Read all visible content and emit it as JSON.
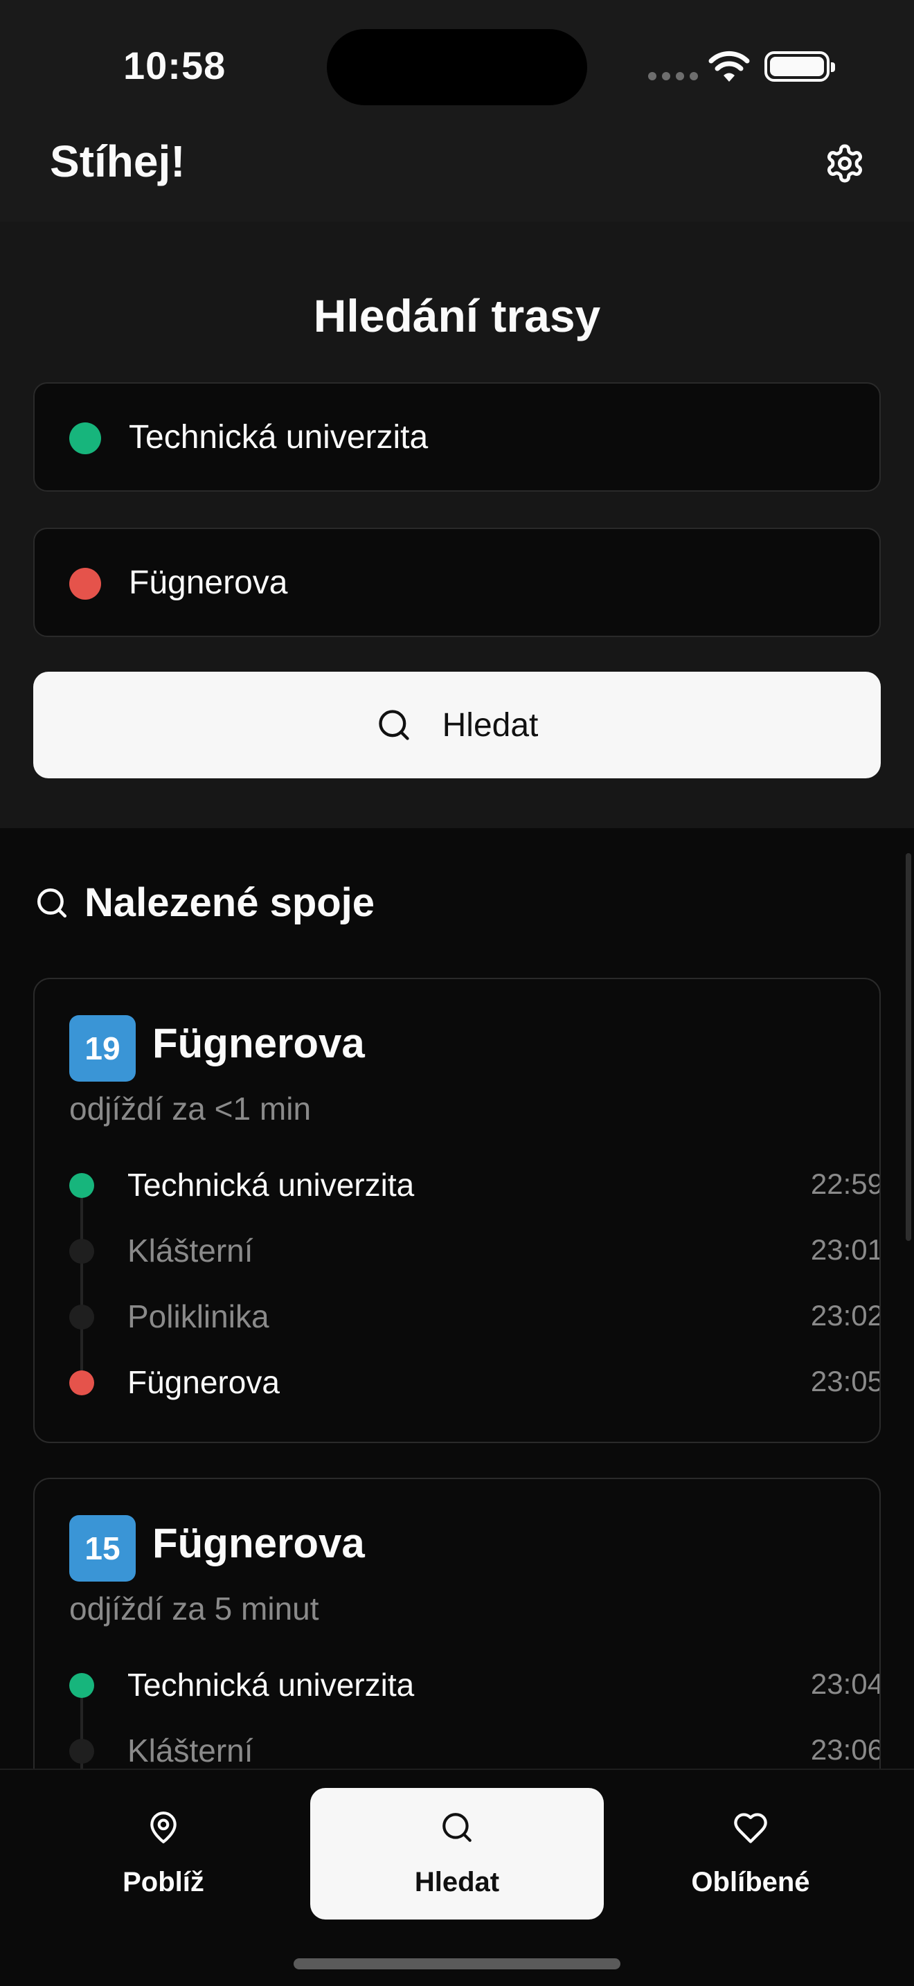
{
  "status": {
    "time": "10:58"
  },
  "header": {
    "title": "Stíhej!",
    "settings_icon": "gear-icon"
  },
  "search": {
    "title": "Hledání trasy",
    "from": {
      "value": "Technická univerzita",
      "color": "#17b57c"
    },
    "to": {
      "value": "Fügnerova",
      "color": "#e5534b"
    },
    "button_label": "Hledat"
  },
  "results": {
    "title": "Nalezené spoje",
    "connections": [
      {
        "line": "19",
        "line_color": "#3a95d6",
        "destination": "Fügnerova",
        "departure": "odjíždí za <1 min",
        "stops": [
          {
            "name": "Technická univerzita",
            "time": "22:59"
          },
          {
            "name": "Klášterní",
            "time": "23:01"
          },
          {
            "name": "Poliklinika",
            "time": "23:02"
          },
          {
            "name": "Fügnerova",
            "time": "23:05"
          }
        ]
      },
      {
        "line": "15",
        "line_color": "#3a95d6",
        "destination": "Fügnerova",
        "departure": "odjíždí za 5 minut",
        "stops": [
          {
            "name": "Technická univerzita",
            "time": "23:04"
          },
          {
            "name": "Klášterní",
            "time": "23:06"
          }
        ]
      }
    ]
  },
  "nav": {
    "items": [
      {
        "label": "Poblíž",
        "icon": "map-pin-icon"
      },
      {
        "label": "Hledat",
        "icon": "search-icon",
        "active": true
      },
      {
        "label": "Oblíbené",
        "icon": "heart-icon"
      }
    ]
  }
}
